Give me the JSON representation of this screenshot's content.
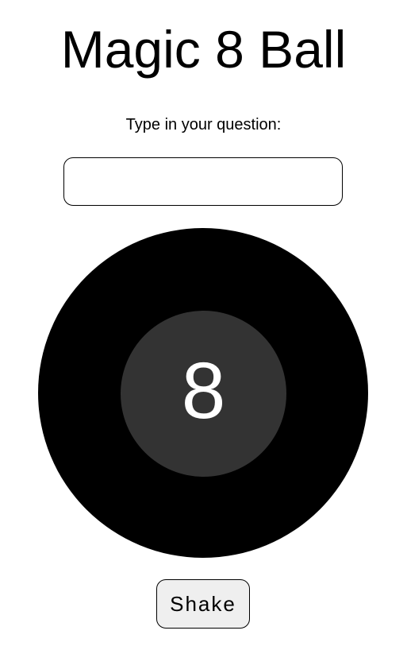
{
  "header": {
    "title": "Magic 8 Ball"
  },
  "form": {
    "prompt_label": "Type in your question:",
    "question_value": "",
    "question_placeholder": ""
  },
  "ball": {
    "display_text": "8",
    "outer_color": "#000000",
    "window_color": "#333333",
    "text_color": "#ffffff"
  },
  "actions": {
    "shake_label": "Shake"
  }
}
